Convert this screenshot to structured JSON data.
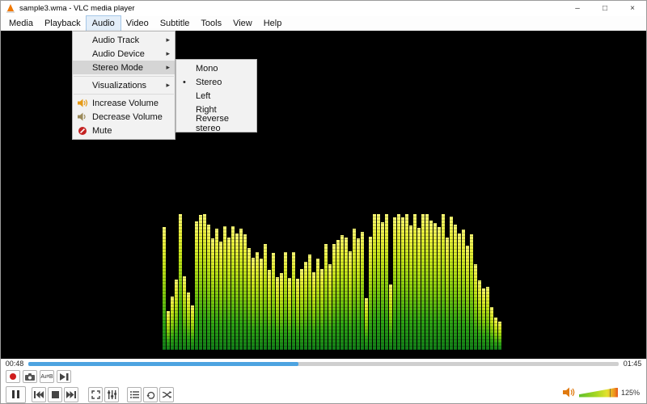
{
  "window": {
    "title": "sample3.wma - VLC media player",
    "controls": {
      "minimize": "–",
      "maximize": "□",
      "close": "×"
    }
  },
  "menubar": {
    "items": [
      {
        "label": "Media"
      },
      {
        "label": "Playback"
      },
      {
        "label": "Audio"
      },
      {
        "label": "Video"
      },
      {
        "label": "Subtitle"
      },
      {
        "label": "Tools"
      },
      {
        "label": "View"
      },
      {
        "label": "Help"
      }
    ]
  },
  "audio_menu": {
    "items": [
      {
        "label": "Audio Track"
      },
      {
        "label": "Audio Device"
      },
      {
        "label": "Stereo Mode"
      },
      {
        "label": "Visualizations"
      },
      {
        "label": "Increase Volume"
      },
      {
        "label": "Decrease Volume"
      },
      {
        "label": "Mute"
      }
    ]
  },
  "stereo_submenu": {
    "items": [
      {
        "label": "Mono"
      },
      {
        "label": "Stereo",
        "selected": true
      },
      {
        "label": "Left"
      },
      {
        "label": "Right"
      },
      {
        "label": "Reverse stereo"
      }
    ]
  },
  "icons": {
    "submenu_arrow": "▸",
    "radio_bullet": "•",
    "ab_loop": "A⇄B"
  },
  "seek": {
    "elapsed": "00:48",
    "total": "01:45",
    "progress_pct": 45.7
  },
  "volume": {
    "value_label": "125%"
  },
  "toolbar_icons": {
    "row1": [
      "record",
      "snapshot",
      "ab-loop",
      "frame-by-frame"
    ],
    "row2": [
      "pause",
      "previous",
      "stop",
      "next",
      "fullscreen",
      "equalizer",
      "playlist",
      "loop",
      "shuffle"
    ]
  },
  "spectrum": {
    "bar_count": 84,
    "seed": 11
  },
  "colors": {
    "seek_fill": "#4da3e0",
    "menu_highlight": "#d5d5d5",
    "record_red": "#cf1d1d",
    "spectrum_bottom": "#117d18",
    "spectrum_top": "#f5f573"
  }
}
